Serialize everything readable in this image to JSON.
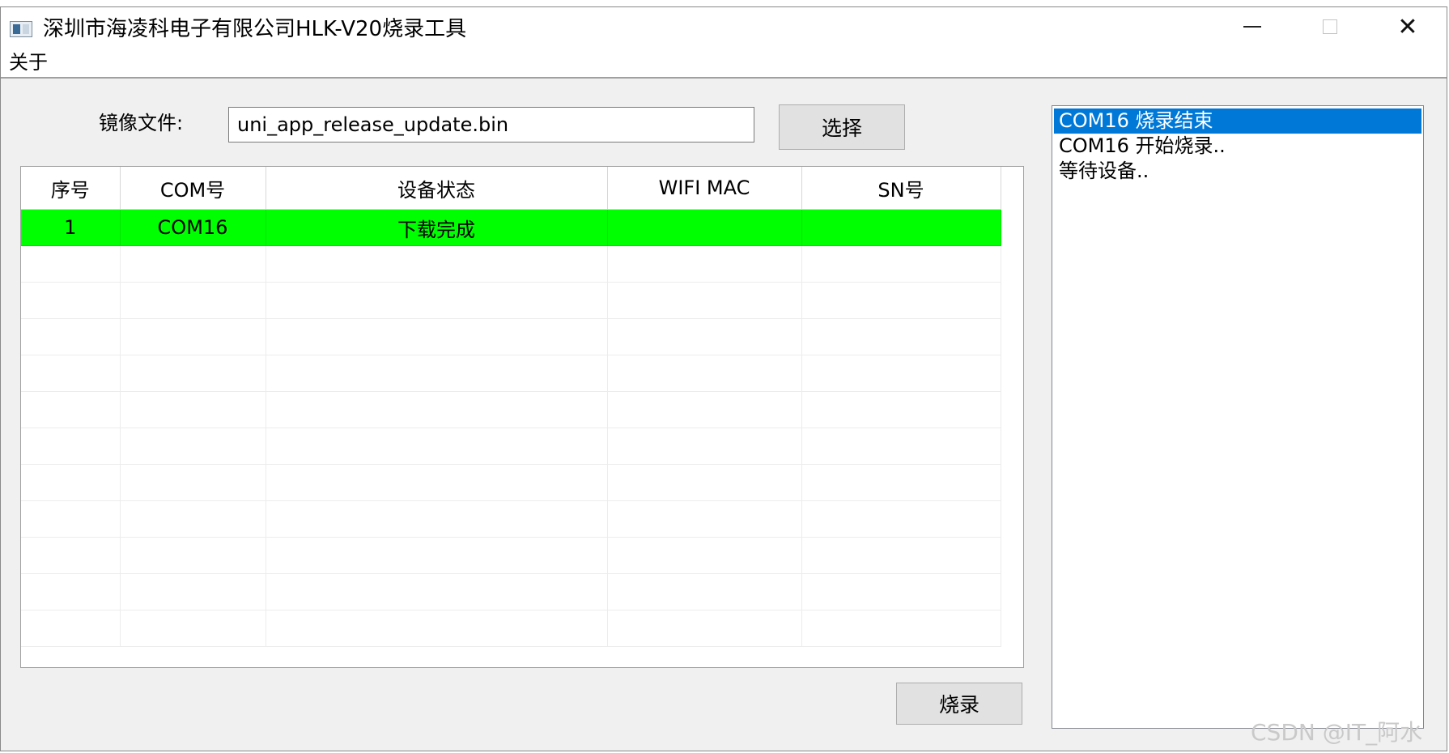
{
  "window": {
    "title": "深圳市海凌科电子有限公司HLK-V20烧录工具",
    "controls": {
      "minimize": "—",
      "maximize": "☐",
      "close": "✕"
    }
  },
  "menu": {
    "items": [
      {
        "label": "关于"
      }
    ]
  },
  "form": {
    "file_label": "镜像文件:",
    "file_value": "uni_app_release_update.bin",
    "select_button": "选择"
  },
  "table": {
    "headers": [
      "序号",
      "COM号",
      "设备状态",
      "WIFI MAC",
      "SN号"
    ],
    "rows": [
      {
        "index": "1",
        "com": "COM16",
        "status": "下载完成",
        "wifi_mac": "",
        "sn": ""
      }
    ],
    "row_status_color": "#00ff00"
  },
  "log": {
    "items": [
      {
        "text": "COM16 烧录结束",
        "selected": true
      },
      {
        "text": "COM16 开始烧录..",
        "selected": false
      },
      {
        "text": "等待设备..",
        "selected": false
      }
    ]
  },
  "actions": {
    "burn_button": "烧录"
  },
  "watermark": "CSDN @IT_阿水",
  "colors": {
    "selection": "#0078d7",
    "success_row": "#00ff00",
    "background": "#f0f0f0"
  }
}
